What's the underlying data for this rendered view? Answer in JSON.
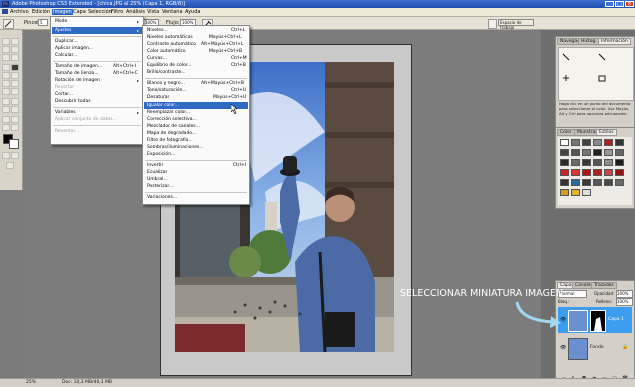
{
  "window": {
    "title": "Adobe Photoshop CS3 Extended - [chica.JPG al 25% (Capa 1, RGB/8)]"
  },
  "menubar": {
    "items": [
      "Archivo",
      "Edición",
      "Imagen",
      "Capa",
      "Selección",
      "Filtro",
      "Análisis",
      "Vista",
      "Ventana",
      "Ayuda"
    ]
  },
  "options": {
    "preset_label": "Pincel:",
    "preset_value": "5",
    "mode_value": "Modo",
    "opacity_label": "Opacidad:",
    "opacity_value": "100%",
    "flow_label": "Flujo:",
    "flow_value": "100%",
    "workspace_label": "Espacio de trabajo"
  },
  "image_menu": {
    "items": [
      "Modo",
      "Ajustes",
      "Duplicar...",
      "Aplicar imagen...",
      "Calcular...",
      "Tamaño de imagen...",
      "Tamaño de lienzo...",
      "Rotación de imagen",
      "Recortar",
      "Cortar...",
      "Descubrir todas",
      "Variables",
      "Aplicar conjunto de datos...",
      "Reventar..."
    ],
    "shortcuts": [
      "Alt+Ctrl+I",
      "Alt+Ctrl+C"
    ]
  },
  "adjust_menu": {
    "items": [
      "Niveles...",
      "Niveles automáticos",
      "Contraste automático",
      "Color automático",
      "Curvas...",
      "Equilibrio de color...",
      "Brillo/contraste...",
      "Blanco y negro...",
      "Tono/saturación...",
      "Desaturar",
      "Igualar color...",
      "Reemplazar color...",
      "Corrección selectiva...",
      "Mezclador de canales...",
      "Mapa de degradado...",
      "Filtro de fotografía...",
      "Sombras/iluminaciones...",
      "Exposición...",
      "Invertir",
      "Ecualizar",
      "Umbral...",
      "Posterizar...",
      "Variaciones..."
    ],
    "shortcuts": [
      "Ctrl+L",
      "Mayús+Ctrl+L",
      "Alt+Mayús+Ctrl+L",
      "Mayús+Ctrl+B",
      "Ctrl+M",
      "Ctrl+B",
      "Alt+Mayús+Ctrl+B",
      "Ctrl+U",
      "Mayús+Ctrl+U",
      "Ctrl+I"
    ],
    "selected": "Igualar color..."
  },
  "navigator_panel": {
    "tabs": [
      "Navegad.",
      "Histog.",
      "Información"
    ],
    "help_text": "Haga clic en un punto del documento para seleccionar el color. Use Mayús, Alt y Ctrl para opciones adicionales."
  },
  "swatches_panel": {
    "tabs": [
      "Color",
      "Muestras",
      "Estilos"
    ]
  },
  "layers_panel": {
    "tabs": [
      "Capas",
      "Canales",
      "Trazados"
    ],
    "blend_mode": "Normal",
    "opacity_label": "Opacidad:",
    "opacity_value": "100%",
    "fill_label": "Relleno:",
    "fill_value": "100%",
    "lock_label": "Bloq.:",
    "layers": [
      {
        "name": "Capa 1",
        "selected": true
      },
      {
        "name": "Fondo",
        "selected": false
      }
    ]
  },
  "statusbar": {
    "zoom": "25%",
    "doc_info": "Doc: 10,3 MB/40,1 MB"
  },
  "annotation": {
    "text": "SELECCIONAR MINIATURA IMAGEN"
  },
  "colors": {
    "accent": "#316ac5",
    "annotation_arrow": "#9fd8f0"
  }
}
